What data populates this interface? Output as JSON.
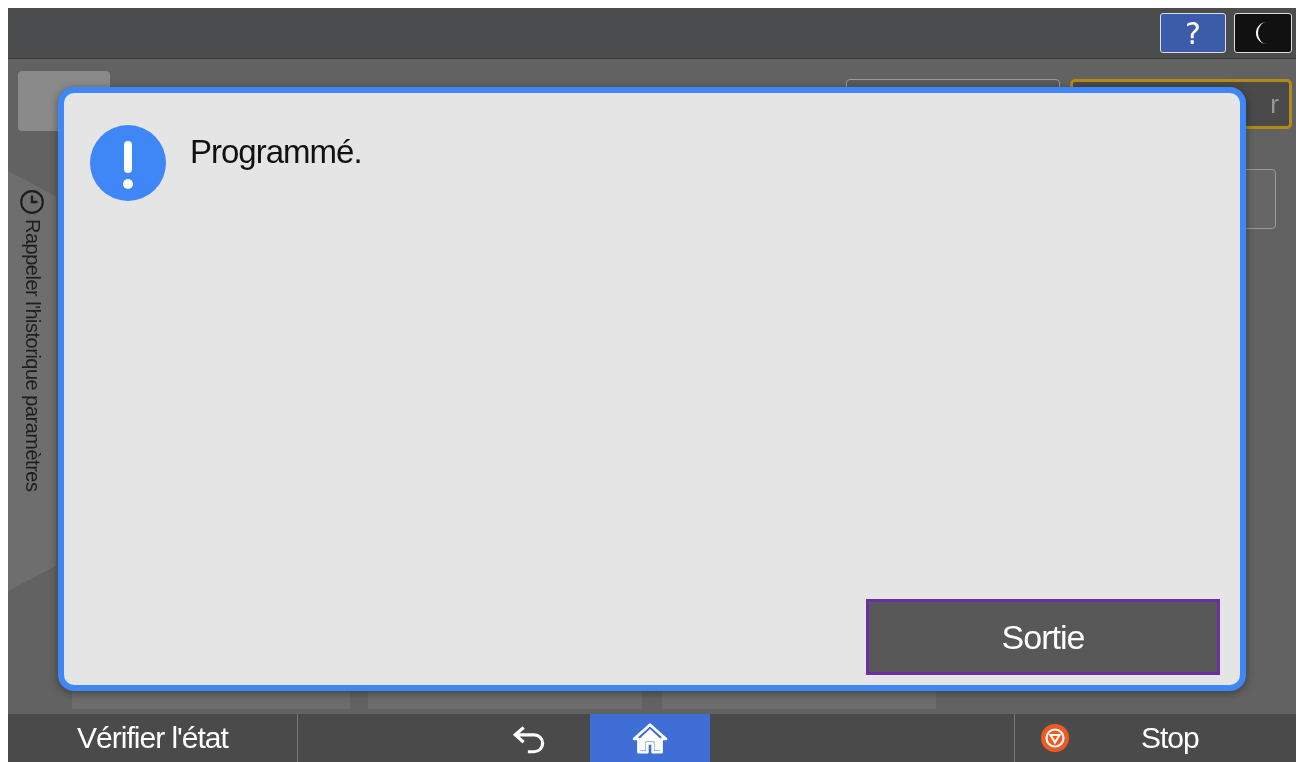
{
  "top_bar": {
    "buttons": [
      {
        "kind": "help",
        "label": "?"
      },
      {
        "kind": "sleep"
      }
    ]
  },
  "background": {
    "side_tab": {
      "label": "Rappeler l'historique paramètres"
    },
    "right_button": {
      "label": "r"
    }
  },
  "dialog": {
    "message": "Programmé.",
    "button": "Sortie"
  },
  "bottom_bar": {
    "status_button": "Vérifier l'état",
    "nav": [
      {
        "kind": "back",
        "selected": false
      },
      {
        "kind": "home",
        "selected": true
      }
    ],
    "stop": "Stop"
  }
}
